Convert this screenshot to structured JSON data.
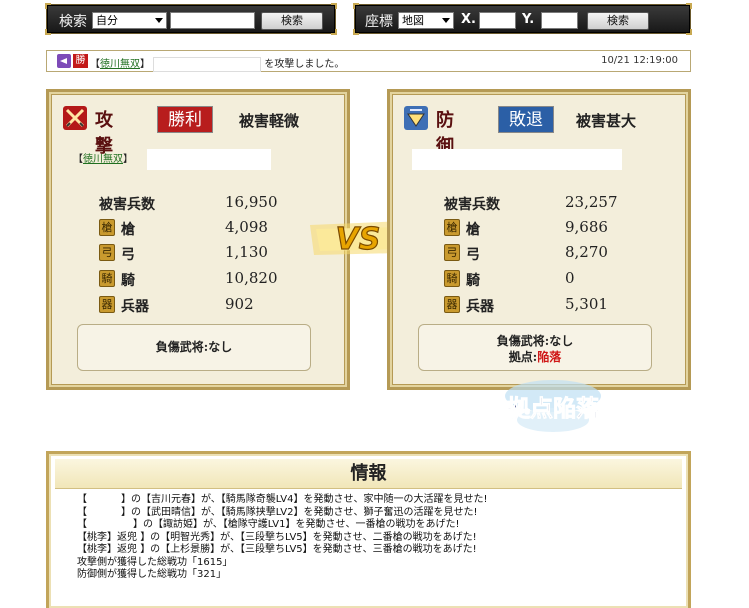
{
  "search_bar": {
    "label": "検索",
    "select_value": "自分",
    "button": "検索"
  },
  "coord_bar": {
    "label": "座標",
    "select_value": "地図",
    "x_label": "X.",
    "y_label": "Y.",
    "button": "検索"
  },
  "notice": {
    "icon_label": "勝",
    "bracket_open": "【",
    "alliance": "徳川無双",
    "bracket_close": "】",
    "message": "を攻撃しました。",
    "time": "10/21 12:19:00"
  },
  "attack": {
    "title": "攻撃",
    "result": "勝利",
    "damage_level": "被害軽微",
    "alliance_open": "【",
    "alliance": "徳川無双",
    "alliance_close": "】",
    "total_label": "被害兵数",
    "total_value": "16,950",
    "rows": [
      {
        "icon": "槍",
        "label": "槍",
        "value": "4,098"
      },
      {
        "icon": "弓",
        "label": "弓",
        "value": "1,130"
      },
      {
        "icon": "騎",
        "label": "騎",
        "value": "10,820"
      },
      {
        "icon": "器",
        "label": "兵器",
        "value": "902"
      }
    ],
    "wounded": "負傷武将:なし"
  },
  "defense": {
    "title": "防御",
    "result": "敗退",
    "damage_level": "被害甚大",
    "total_label": "被害兵数",
    "total_value": "23,257",
    "rows": [
      {
        "icon": "槍",
        "label": "槍",
        "value": "9,686"
      },
      {
        "icon": "弓",
        "label": "弓",
        "value": "8,270"
      },
      {
        "icon": "騎",
        "label": "騎",
        "value": "0"
      },
      {
        "icon": "器",
        "label": "兵器",
        "value": "5,301"
      }
    ],
    "wounded": "負傷武将:なし",
    "base_label": "拠点:",
    "base_status": "陥落"
  },
  "vs_label": "VS",
  "fallen_badge": "拠点陥落",
  "info": {
    "title": "情報",
    "lines": [
      {
        "pre": "【",
        "post": "】の【吉川元春】が、【騎馬隊奇襲LV4】を発動させ、家中随一の大活躍を見せた!"
      },
      {
        "pre": "【",
        "post": "】の【武田晴信】が、【騎馬隊挟撃LV2】を発動させ、獅子奮迅の活躍を見せた!"
      },
      {
        "pre": "【",
        "post": "】の【諏訪姫】が、【槍隊守護LV1】を発動させ、一番槍の戦功をあげた!"
      },
      {
        "pre": "【桃李】返兜 ",
        "post": "】の【明智光秀】が、【三段撃ちLV5】を発動させ、二番槍の戦功をあげた!"
      },
      {
        "pre": "【桃李】返兜 ",
        "post": "】の【上杉景勝】が、【三段撃ちLV5】を発動させ、三番槍の戦功をあげた!"
      },
      {
        "pre": "攻撃側が獲得した総戦功「1615」",
        "post": ""
      },
      {
        "pre": "防御側が獲得した総戦功「321」",
        "post": ""
      }
    ]
  },
  "colors": {
    "win_red": "#b81d1d",
    "lose_blue": "#2b5fa6",
    "fallen_red": "#d01818",
    "link_green": "#1f6f1f"
  }
}
